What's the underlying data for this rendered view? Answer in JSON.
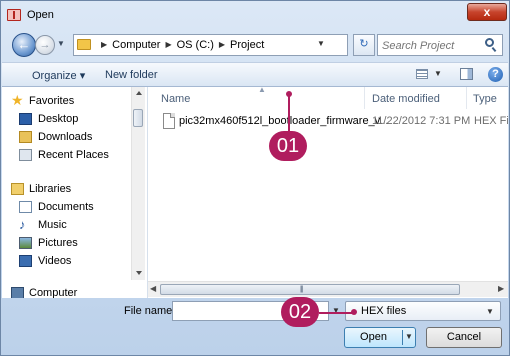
{
  "window": {
    "title": "Open",
    "close_glyph": "x"
  },
  "address_bar": {
    "crumbs": [
      "Computer",
      "OS (C:)",
      "Project"
    ],
    "search_placeholder": "Search Project"
  },
  "command_bar": {
    "organize_label": "Organize ▾",
    "new_folder_label": "New folder",
    "help_glyph": "?"
  },
  "nav": {
    "favorites_label": "Favorites",
    "desktop_label": "Desktop",
    "downloads_label": "Downloads",
    "recent_label": "Recent Places",
    "libraries_label": "Libraries",
    "documents_label": "Documents",
    "music_label": "Music",
    "pictures_label": "Pictures",
    "videos_label": "Videos",
    "computer_label": "Computer"
  },
  "file_list": {
    "columns": [
      "Name",
      "Date modified",
      "Type"
    ],
    "files": [
      {
        "name": "pic32mx460f512l_bootloader_firmware_v...",
        "date": "11/22/2012 7:31 PM",
        "type": "HEX File"
      }
    ]
  },
  "bottom": {
    "file_name_label": "File name:",
    "file_name_value": "",
    "filter_value": "HEX files",
    "open_label": "Open",
    "cancel_label": "Cancel"
  },
  "annotations": {
    "callout_1": "01",
    "callout_2": "02"
  },
  "colors": {
    "callout": "#b01d5e",
    "window_frame": "#c6d8ee"
  },
  "icons": [
    "back-arrow-icon",
    "forward-arrow-icon",
    "folder-icon",
    "refresh-icon",
    "search-icon",
    "views-icon",
    "preview-pane-icon",
    "help-icon",
    "star-icon",
    "desktop-icon",
    "downloads-icon",
    "recent-places-icon",
    "libraries-icon",
    "documents-icon",
    "music-icon",
    "pictures-icon",
    "videos-icon",
    "computer-icon",
    "file-icon"
  ]
}
